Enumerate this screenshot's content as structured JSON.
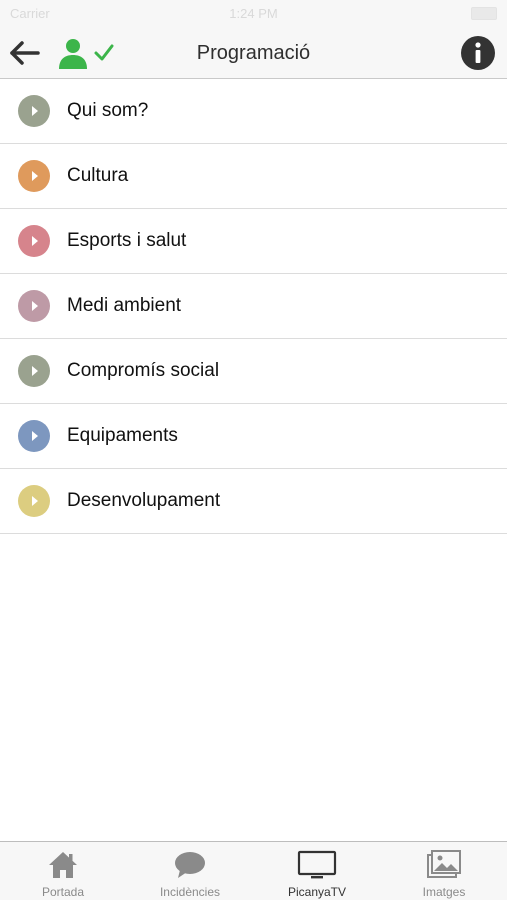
{
  "status_bar": {
    "carrier": "Carrier",
    "time": "1:24 PM"
  },
  "nav": {
    "title": "Programació",
    "back_icon": "arrow-left-icon",
    "user_icon": "user-verified-icon",
    "info_icon": "info-icon",
    "user_color": "#3cb54a",
    "check_color": "#3cb54a",
    "info_color": "#333333"
  },
  "menu": {
    "items": [
      {
        "label": "Qui som?",
        "color": "#9aa28f"
      },
      {
        "label": "Cultura",
        "color": "#df9a5c"
      },
      {
        "label": "Esports i salut",
        "color": "#d6848c"
      },
      {
        "label": "Medi ambient",
        "color": "#be9aa6"
      },
      {
        "label": "Compromís social",
        "color": "#9aa28f"
      },
      {
        "label": "Equipaments",
        "color": "#7d97bf"
      },
      {
        "label": "Desenvolupament",
        "color": "#dccd80"
      }
    ]
  },
  "tabs": [
    {
      "label": "Portada",
      "icon": "home-icon"
    },
    {
      "label": "Incidències",
      "icon": "chat-bubble-icon"
    },
    {
      "label": "PicanyaTV",
      "icon": "tv-icon",
      "active": true
    },
    {
      "label": "Imatges",
      "icon": "images-icon"
    }
  ]
}
